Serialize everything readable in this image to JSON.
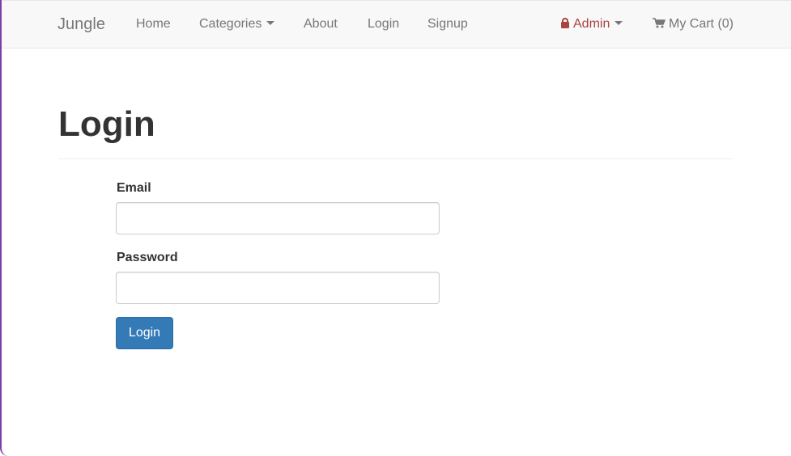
{
  "navbar": {
    "brand": "Jungle",
    "links": {
      "home": "Home",
      "categories": "Categories",
      "about": "About",
      "login": "Login",
      "signup": "Signup"
    },
    "admin": "Admin",
    "cart": "My Cart (0)"
  },
  "page": {
    "title": "Login"
  },
  "form": {
    "email_label": "Email",
    "email_value": "",
    "password_label": "Password",
    "password_value": "",
    "submit_label": "Login"
  },
  "colors": {
    "navbar_bg": "#f8f8f8",
    "nav_text": "#777777",
    "admin_text": "#a94442",
    "primary_button": "#337ab7"
  },
  "icons": {
    "categories_toggle": "caret-down-icon",
    "admin_lock": "lock-icon",
    "admin_toggle": "caret-down-icon",
    "cart": "shopping-cart-icon"
  }
}
